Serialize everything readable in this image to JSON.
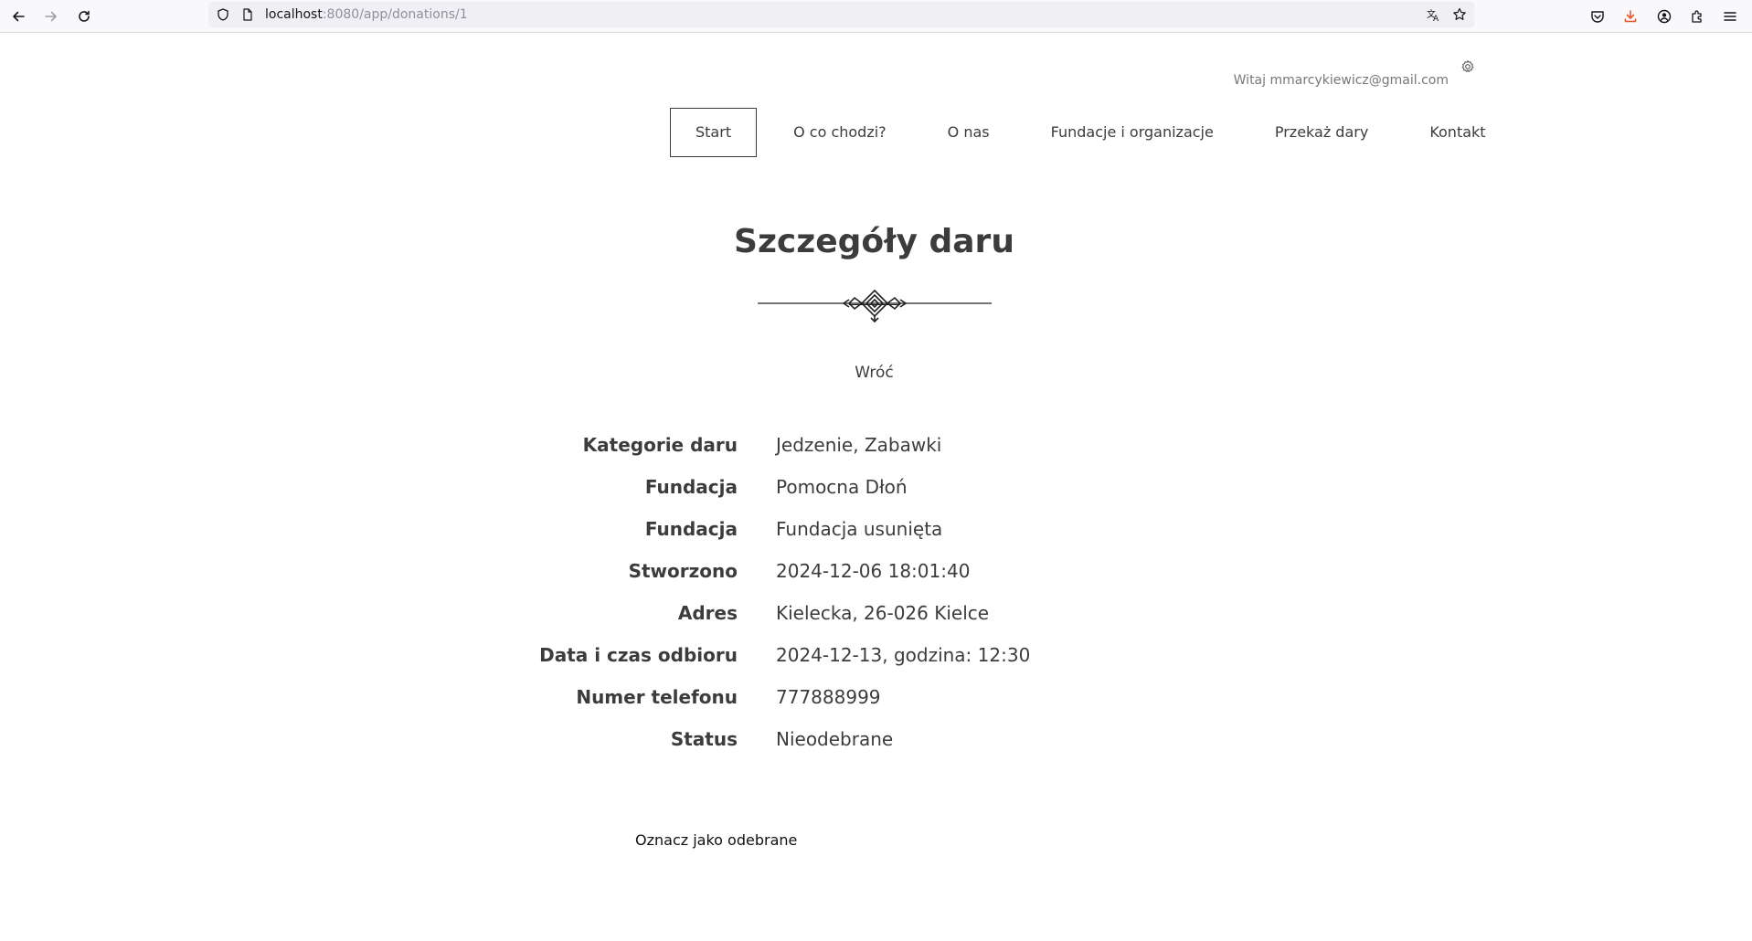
{
  "browser": {
    "url_host": "localhost",
    "url_rest": ":8080/app/donations/1"
  },
  "header": {
    "welcome_text": "Witaj mmarcykiewicz@gmail.com"
  },
  "nav": {
    "items": [
      {
        "label": "Start",
        "active": true
      },
      {
        "label": "O co chodzi?"
      },
      {
        "label": "O nas"
      },
      {
        "label": "Fundacje i organizacje"
      },
      {
        "label": "Przekaż dary"
      },
      {
        "label": "Kontakt"
      }
    ]
  },
  "main": {
    "title": "Szczegóły daru",
    "back_label": "Wróć",
    "details": [
      {
        "label": "Kategorie daru",
        "value": "Jedzenie, Zabawki"
      },
      {
        "label": "Fundacja",
        "value": "Pomocna Dłoń"
      },
      {
        "label": "Fundacja",
        "value": "Fundacja usunięta"
      },
      {
        "label": "Stworzono",
        "value": "2024-12-06 18:01:40"
      },
      {
        "label": "Adres",
        "value": "Kielecka, 26-026 Kielce"
      },
      {
        "label": "Data i czas odbioru",
        "value": "2024-12-13, godzina: 12:30"
      },
      {
        "label": "Numer telefonu",
        "value": "777888999"
      },
      {
        "label": "Status",
        "value": "Nieodebrane"
      }
    ],
    "mark_received_label": "Oznacz jako odebrane"
  },
  "icons": {
    "back": "arrow-left-icon",
    "forward": "arrow-right-icon",
    "reload": "reload-icon",
    "shield": "shield-icon",
    "page": "page-icon",
    "translate": "translate-icon",
    "bookmark": "star-icon",
    "pocket": "pocket-icon",
    "downloads": "download-icon",
    "account": "account-icon",
    "extensions": "puzzle-icon",
    "menu": "hamburger-menu-icon",
    "settings": "gear-icon"
  },
  "colors": {
    "text": "#3c3c3c",
    "download_accent": "#e8572d"
  }
}
